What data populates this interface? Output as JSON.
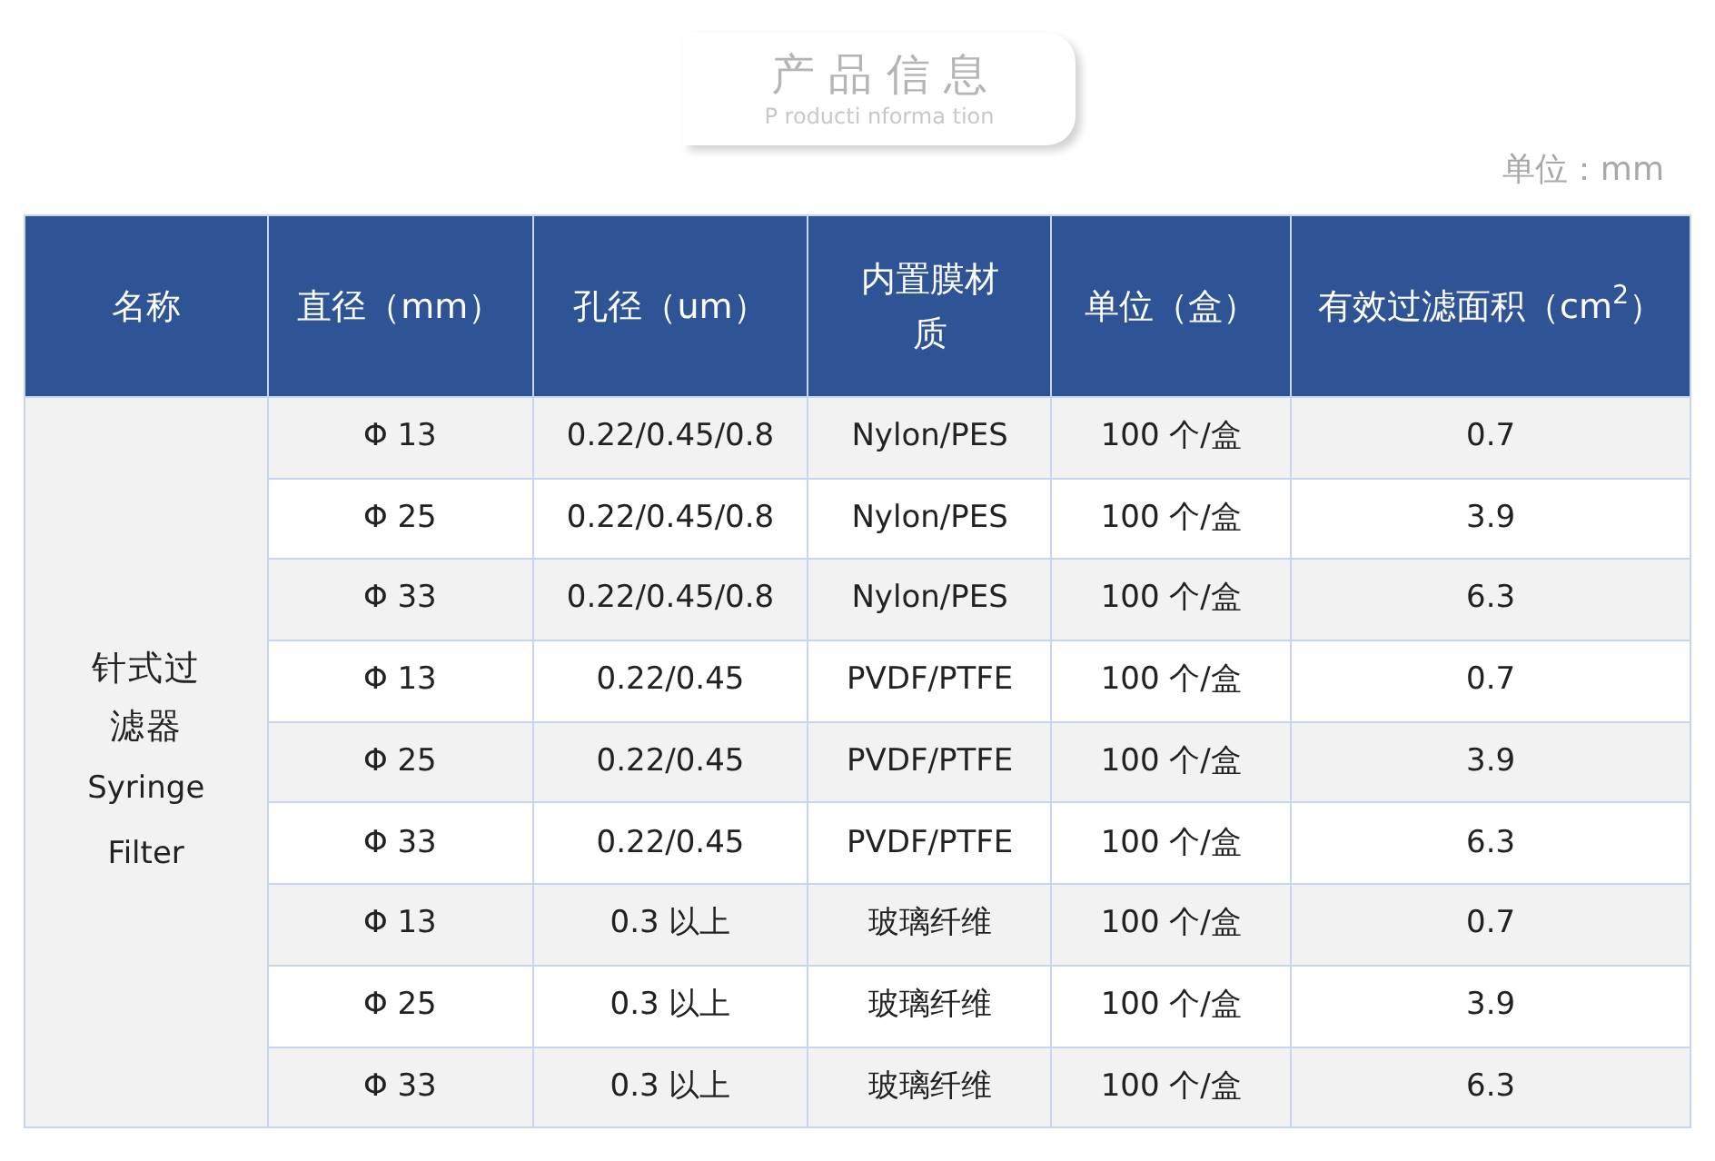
{
  "title": "产 品 信 息",
  "subtitle": "P roducti nforma tion",
  "unit_note": "单位：mm",
  "table": {
    "columns": [
      "名称",
      "直径（mm）",
      "孔径（um）",
      "内置膜材质",
      "单位（盒）",
      "有效过滤面积（cm$^{2}$）"
    ],
    "name_cell": {
      "name": "针式过滤器",
      "name_en": [
        "Syringe",
        "Filter"
      ]
    },
    "rows": [
      {
        "diameter": "Φ 13",
        "pore": "0.22/0.45/0.8",
        "membrane": "Nylon/PES",
        "unit": "100 个/盒",
        "area": "0.7"
      },
      {
        "diameter": "Φ 25",
        "pore": "0.22/0.45/0.8",
        "membrane": "Nylon/PES",
        "unit": "100 个/盒",
        "area": "3.9"
      },
      {
        "diameter": "Φ 33",
        "pore": "0.22/0.45/0.8",
        "membrane": "Nylon/PES",
        "unit": "100 个/盒",
        "area": "6.3"
      },
      {
        "diameter": "Φ 13",
        "pore": "0.22/0.45",
        "membrane": "PVDF/PTFE",
        "unit": "100 个/盒",
        "area": "0.7"
      },
      {
        "diameter": "Φ 25",
        "pore": "0.22/0.45",
        "membrane": "PVDF/PTFE",
        "unit": "100 个/盒",
        "area": "3.9"
      },
      {
        "diameter": "Φ 33",
        "pore": "0.22/0.45",
        "membrane": "PVDF/PTFE",
        "unit": "100 个/盒",
        "area": "6.3"
      },
      {
        "diameter": "Φ 13",
        "pore": "0.3 以上",
        "membrane": "玻璃纤维",
        "unit": "100 个/盒",
        "area": "0.7"
      },
      {
        "diameter": "Φ 25",
        "pore": "0.3 以上",
        "membrane": "玻璃纤维",
        "unit": "100 个/盒",
        "area": "3.9"
      },
      {
        "diameter": "Φ 33",
        "pore": "0.3 以上",
        "membrane": "玻璃纤维",
        "unit": "100 个/盒",
        "area": "6.3"
      }
    ]
  }
}
